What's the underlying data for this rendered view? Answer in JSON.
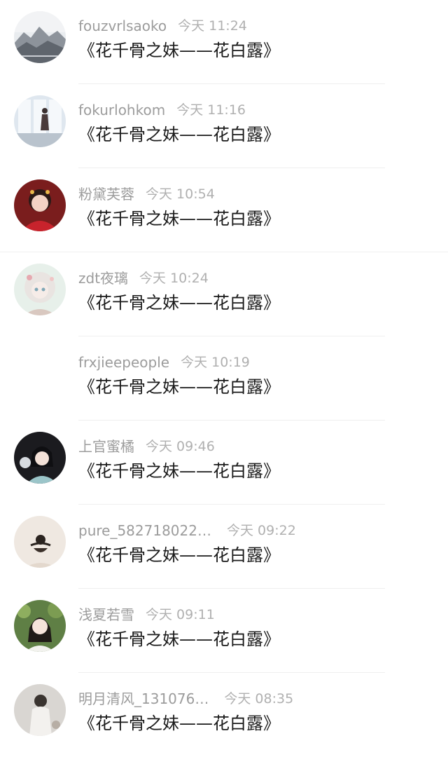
{
  "comments": [
    {
      "username": "fouzvrlsaoko",
      "time": "今天 11:24",
      "message": "《花千骨之妹——花白露》",
      "avatar": "landscape-painting-avatar"
    },
    {
      "username": "fokurlohkom",
      "time": "今天 11:16",
      "message": "《花千骨之妹——花白露》",
      "avatar": "window-silhouette-avatar"
    },
    {
      "username": "粉黛芙蓉",
      "time": "今天 10:54",
      "message": "《花千骨之妹——花白露》",
      "avatar": "red-costume-girl-avatar"
    },
    {
      "username": "zdt夜璃",
      "time": "今天 10:24",
      "message": "《花千骨之妹——花白露》",
      "avatar": "illustrated-girl-avatar"
    },
    {
      "username": "frxjieepeople",
      "time": "今天 10:19",
      "message": "《花千骨之妹——花白露》",
      "avatar": ""
    },
    {
      "username": "上官蜜橘",
      "time": "今天 09:46",
      "message": "《花千骨之妹——花白露》",
      "avatar": "dark-hair-girl-avatar"
    },
    {
      "username": "pure_582718022…",
      "time": "今天 09:22",
      "message": "《花千骨之妹——花白露》",
      "avatar": "hair-bun-avatar"
    },
    {
      "username": "浅夏若雪",
      "time": "今天 09:11",
      "message": "《花千骨之妹——花白露》",
      "avatar": "garden-girl-avatar"
    },
    {
      "username": "明月清风_131076…",
      "time": "今天 08:35",
      "message": "《花千骨之妹——花白露》",
      "avatar": "light-outfit-avatar"
    }
  ]
}
